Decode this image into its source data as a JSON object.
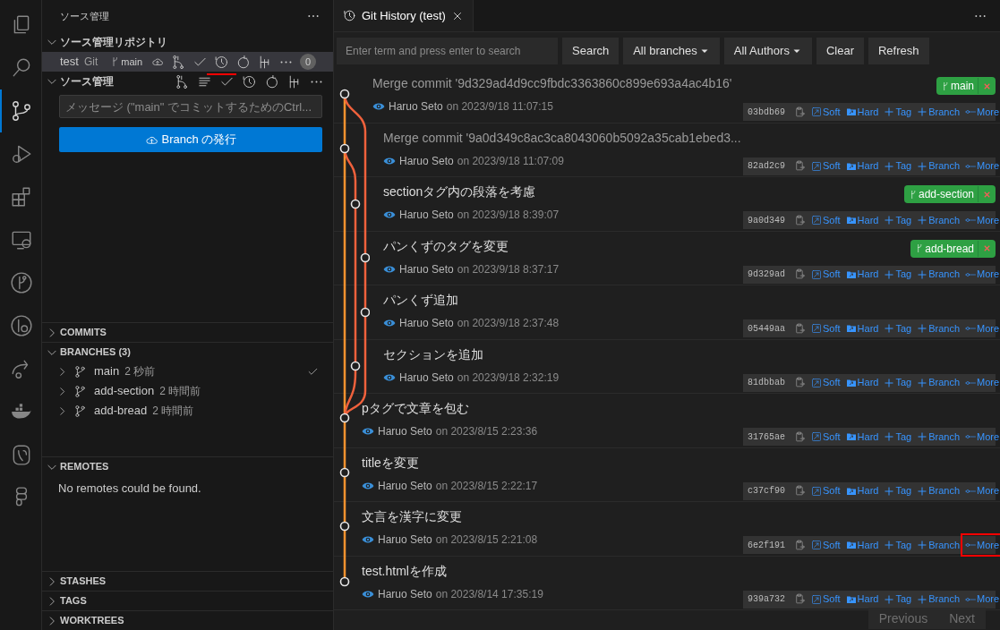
{
  "activity_bar": [
    {
      "kind": "files",
      "selected": false
    },
    {
      "kind": "search",
      "selected": false
    },
    {
      "kind": "source-control",
      "selected": true
    },
    {
      "kind": "run-debug",
      "selected": false
    },
    {
      "kind": "extensions",
      "selected": false
    },
    {
      "kind": "remote",
      "selected": false
    },
    {
      "kind": "graph",
      "selected": false
    },
    {
      "kind": "history",
      "selected": false
    },
    {
      "kind": "share",
      "selected": false
    },
    {
      "kind": "whale",
      "selected": false
    },
    {
      "kind": "elephant",
      "selected": false
    },
    {
      "kind": "figma",
      "selected": false
    }
  ],
  "sidebar": {
    "title": "ソース管理",
    "repositories": {
      "title": "ソース管理リポジトリ",
      "expanded": true,
      "repo": {
        "name": "test",
        "type": "Git",
        "branch": "main",
        "badge": "0",
        "selected": true,
        "history_highlighted": true
      }
    },
    "scm": {
      "title": "ソース管理",
      "expanded": true,
      "message_placeholder": "メッセージ (\"main\" でコミットするためのCtrl...",
      "publish_button": "Branch の発行"
    },
    "sections": [
      {
        "title": "COMMITS",
        "expanded": false
      },
      {
        "title": "BRANCHES (3)",
        "expanded": true,
        "items": [
          {
            "name": "main",
            "age": "2 秒前",
            "current": true
          },
          {
            "name": "add-section",
            "age": "2 時間前",
            "current": false
          },
          {
            "name": "add-bread",
            "age": "2 時間前",
            "current": false
          }
        ]
      },
      {
        "title": "REMOTES",
        "expanded": true,
        "message": "No remotes could be found."
      },
      {
        "title": "STASHES",
        "expanded": false
      },
      {
        "title": "TAGS",
        "expanded": false
      },
      {
        "title": "WORKTREES",
        "expanded": false
      }
    ]
  },
  "tab": {
    "title": "Git History (test)",
    "selected": true
  },
  "toolbar": {
    "search_placeholder": "Enter term and press enter to search",
    "buttons": [
      {
        "label": "Search",
        "dropdown": false
      },
      {
        "label": "All branches",
        "dropdown": true
      },
      {
        "label": "All Authors",
        "dropdown": true
      },
      {
        "label": "Clear",
        "dropdown": false
      },
      {
        "label": "Refresh",
        "dropdown": false
      }
    ]
  },
  "commits": [
    {
      "kind": "merge",
      "title": "Merge commit '9d329ad4d9cc9fbdc3363860c899e693a4ac4b16'",
      "author": "Haruo Seto",
      "on": "on",
      "date": "2023/9/18 11:07:15",
      "hash": "03bdb69",
      "branch": "main",
      "actions": [
        "Soft",
        "Hard",
        "Tag",
        "Branch",
        "More"
      ]
    },
    {
      "kind": "merge",
      "title": "Merge commit '9a0d349c8ac3ca8043060b5092a35cab1ebed3...",
      "author": "Haruo Seto",
      "on": "on",
      "date": "2023/9/18 11:07:09",
      "hash": "82ad2c9",
      "actions": [
        "Soft",
        "Hard",
        "Tag",
        "Branch",
        "More"
      ]
    },
    {
      "kind": "commit",
      "title": "sectionタグ内の段落を考慮",
      "author": "Haruo Seto",
      "on": "on",
      "date": "2023/9/18 8:39:07",
      "hash": "9a0d349",
      "branch": "add-section",
      "actions": [
        "Soft",
        "Hard",
        "Tag",
        "Branch",
        "More"
      ]
    },
    {
      "kind": "commit",
      "title": "パンくずのタグを変更",
      "author": "Haruo Seto",
      "on": "on",
      "date": "2023/9/18 8:37:17",
      "hash": "9d329ad",
      "branch": "add-bread",
      "actions": [
        "Soft",
        "Hard",
        "Tag",
        "Branch",
        "More"
      ]
    },
    {
      "kind": "commit",
      "title": "パンくず追加",
      "author": "Haruo Seto",
      "on": "on",
      "date": "2023/9/18 2:37:48",
      "hash": "05449aa",
      "actions": [
        "Soft",
        "Hard",
        "Tag",
        "Branch",
        "More"
      ]
    },
    {
      "kind": "commit",
      "title": "セクションを追加",
      "author": "Haruo Seto",
      "on": "on",
      "date": "2023/9/18 2:32:19",
      "hash": "81dbbab",
      "actions": [
        "Soft",
        "Hard",
        "Tag",
        "Branch",
        "More"
      ]
    },
    {
      "kind": "commit",
      "title": "pタグで文章を包む",
      "author": "Haruo Seto",
      "on": "on",
      "date": "2023/8/15 2:23:36",
      "hash": "31765ae",
      "actions": [
        "Soft",
        "Hard",
        "Tag",
        "Branch",
        "More"
      ]
    },
    {
      "kind": "commit",
      "title": "titleを変更",
      "author": "Haruo Seto",
      "on": "on",
      "date": "2023/8/15 2:22:17",
      "hash": "c37cf90",
      "actions": [
        "Soft",
        "Hard",
        "Tag",
        "Branch",
        "More"
      ]
    },
    {
      "kind": "commit",
      "title": "文言を漢字に変更",
      "author": "Haruo Seto",
      "on": "on",
      "date": "2023/8/15 2:21:08",
      "hash": "6e2f191",
      "more_highlighted": true,
      "actions": [
        "Soft",
        "Hard",
        "Tag",
        "Branch",
        "More"
      ]
    },
    {
      "kind": "commit",
      "title": "test.htmlを作成",
      "author": "Haruo Seto",
      "on": "on",
      "date": "2023/8/14 17:35:19",
      "hash": "939a732",
      "actions": [
        "Soft",
        "Hard",
        "Tag",
        "Branch",
        "More"
      ]
    }
  ],
  "pagination": [
    {
      "label": "Previous",
      "disabled": true
    },
    {
      "label": "Next",
      "disabled": true
    }
  ]
}
